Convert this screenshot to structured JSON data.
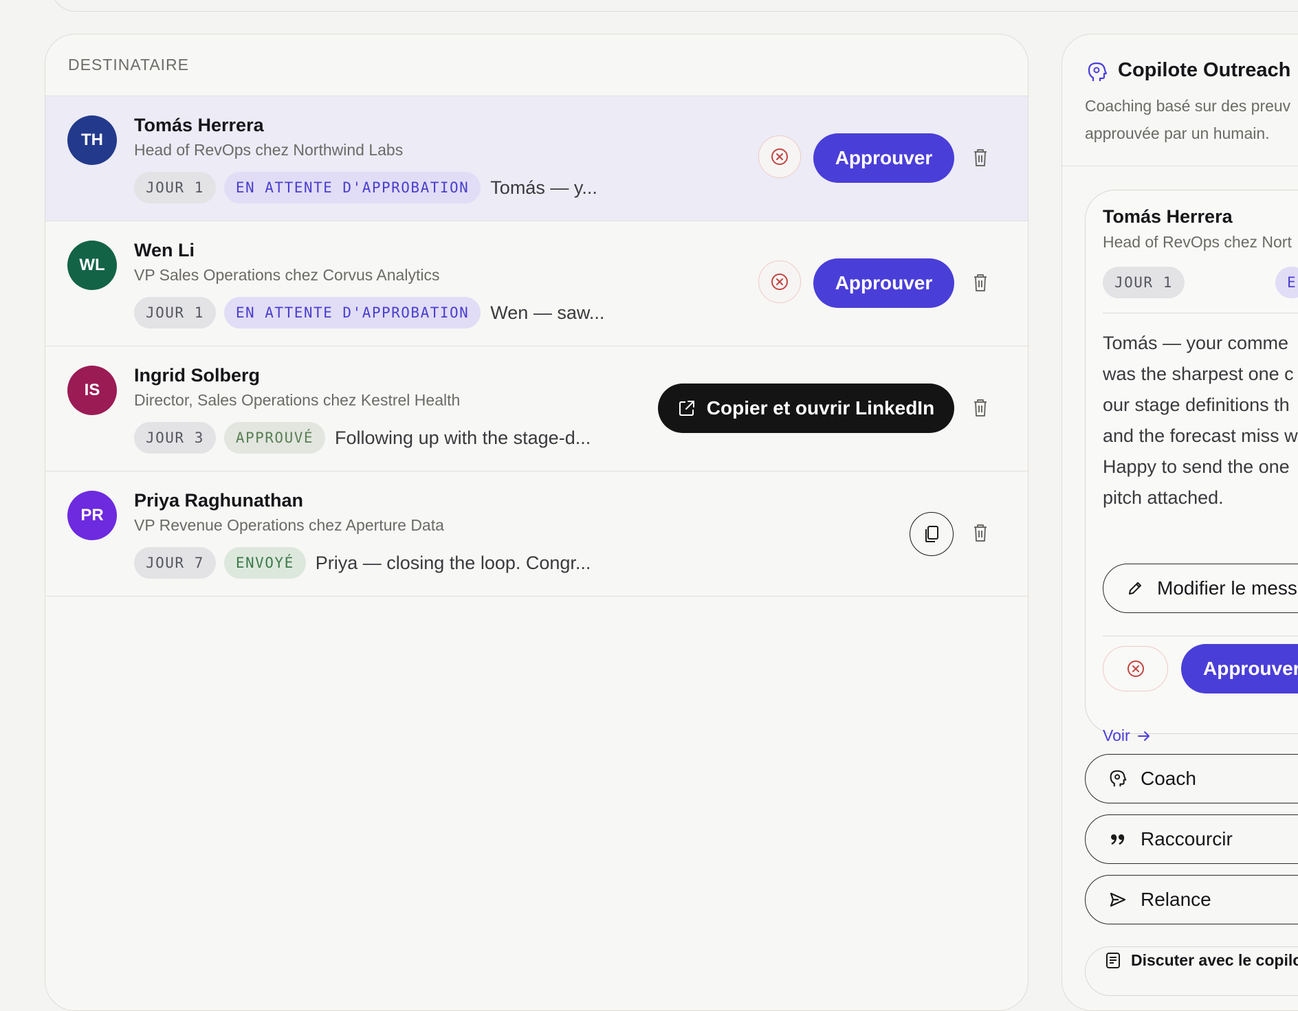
{
  "list": {
    "header": "DESTINATAIRE",
    "rows": [
      {
        "initials": "TH",
        "name": "Tomás Herrera",
        "role": "Head of RevOps chez Northwind Labs",
        "day": "JOUR 1",
        "status": "EN ATTENTE D'APPROBATION",
        "preview": "Tomás — y...",
        "avatar_color": "#233a8c",
        "action_label": "Approuver"
      },
      {
        "initials": "WL",
        "name": "Wen Li",
        "role": "VP Sales Operations chez Corvus Analytics",
        "day": "JOUR 1",
        "status": "EN ATTENTE D'APPROBATION",
        "preview": "Wen — saw...",
        "avatar_color": "#136347",
        "action_label": "Approuver"
      },
      {
        "initials": "IS",
        "name": "Ingrid Solberg",
        "role": "Director, Sales Operations chez Kestrel Health",
        "day": "JOUR 3",
        "status": "APPROUVÉ",
        "preview": "Following up with the stage-d...",
        "avatar_color": "#9b1b55",
        "action_label": "Copier et ouvrir LinkedIn"
      },
      {
        "initials": "PR",
        "name": "Priya Raghunathan",
        "role": "VP Revenue Operations chez Aperture Data",
        "day": "JOUR 7",
        "status": "ENVOYÉ",
        "preview": "Priya — closing the loop. Congr...",
        "avatar_color": "#6d2adf"
      }
    ]
  },
  "copilot": {
    "title": "Copilote Outreach",
    "subtitle_lines": [
      "Coaching basé sur des preuv",
      "approuvée par un humain."
    ],
    "draft": {
      "name": "Tomás Herrera",
      "role": "Head of RevOps chez Nort",
      "day": "JOUR 1",
      "status_fragment": "E",
      "body_lines": [
        "Tomás — your comme",
        "was the sharpest one c",
        "our stage definitions th",
        "and the forecast miss w",
        "Happy to send the one",
        "pitch attached."
      ],
      "edit_label": "Modifier le mess",
      "approve_label": "Approuver",
      "link_label": "Voir"
    },
    "actions": [
      {
        "label": "Coach",
        "icon": "brain-icon"
      },
      {
        "label": "Raccourcir",
        "icon": "quote-icon"
      },
      {
        "label": "Relance",
        "icon": "send-icon"
      }
    ],
    "chat_label": "Discuter avec le copilo"
  },
  "colors": {
    "accent": "#4a3ed8",
    "pending_chip_bg": "#e1ddf6",
    "selected_row_bg": "#ecebf6",
    "dark_button": "#141414",
    "reject_icon": "#c0443e"
  }
}
